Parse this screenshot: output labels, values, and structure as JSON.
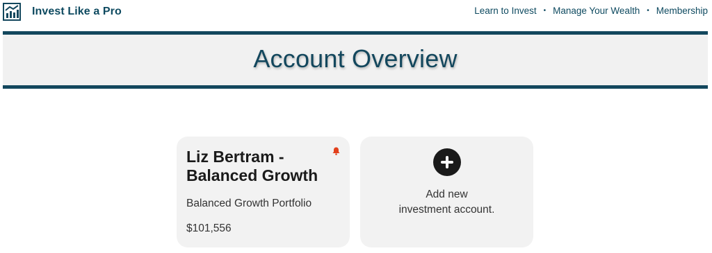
{
  "header": {
    "brand_name": "Invest Like a Pro",
    "logo_icon": "chart-trend-icon",
    "nav": [
      {
        "label": "Learn to Invest"
      },
      {
        "label": "Manage Your Wealth"
      },
      {
        "label": "Membership"
      }
    ],
    "separator": "•"
  },
  "hero": {
    "title": "Account Overview"
  },
  "accounts": [
    {
      "name": "Liz Bertram - Balanced Growth",
      "portfolio": "Balanced Growth Portfolio",
      "balance": "$101,556",
      "alert_icon": "bell-icon"
    }
  ],
  "add_account": {
    "line1": "Add new",
    "line2": "investment account.",
    "icon": "plus-circle-icon"
  },
  "colors": {
    "brand": "#13475d",
    "alert": "#e2401c",
    "card_bg": "#f2f2f2"
  }
}
